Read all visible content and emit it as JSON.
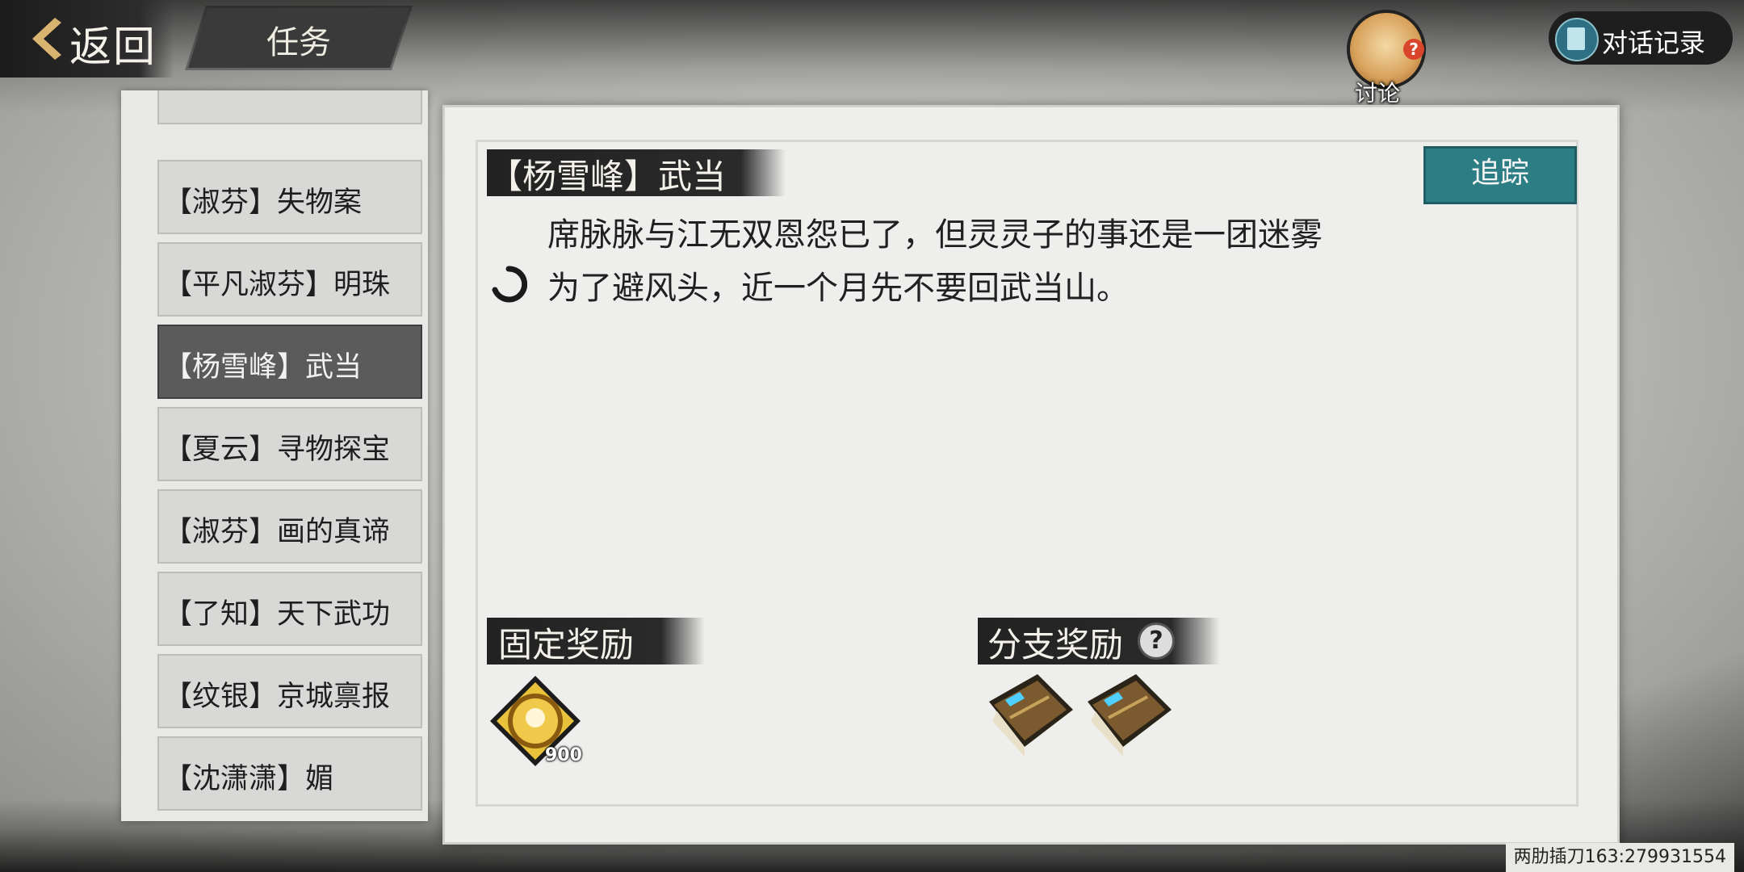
{
  "header": {
    "back_label": "返回",
    "title": "任务",
    "discuss_label": "讨论",
    "dialog_log_label": "对话记录"
  },
  "quest_list": [
    {
      "label": "【淑芬】失物案",
      "active": false
    },
    {
      "label": "【平凡淑芬】明珠",
      "active": false
    },
    {
      "label": "【杨雪峰】武当",
      "active": true
    },
    {
      "label": "【夏云】寻物探宝",
      "active": false
    },
    {
      "label": "【淑芬】画的真谛",
      "active": false
    },
    {
      "label": "【了知】天下武功",
      "active": false
    },
    {
      "label": "【纹银】京城禀报",
      "active": false
    },
    {
      "label": "【沈潇潇】媚",
      "active": false
    }
  ],
  "quest": {
    "title": "【杨雪峰】武当",
    "track_label": "追踪",
    "description_lines": [
      "席脉脉与江无双恩怨已了，但灵灵子的事还是一团迷雾",
      "为了避风头，近一个月先不要回武当山。"
    ]
  },
  "rewards": {
    "fixed_label": "固定奖励",
    "fixed_items": [
      {
        "icon": "gold-orb-icon",
        "count": "900"
      }
    ],
    "branch_label": "分支奖励",
    "branch_help": "?",
    "branch_items": [
      {
        "icon": "skill-book-icon"
      },
      {
        "icon": "skill-book-icon"
      }
    ]
  },
  "watermark": "两肋插刀163:279931554"
}
